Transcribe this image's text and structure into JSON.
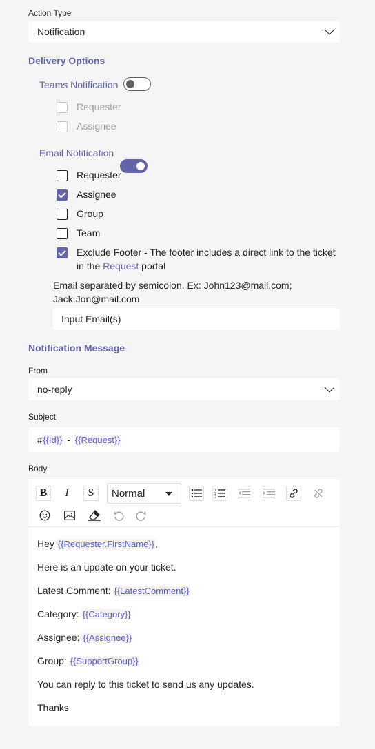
{
  "action_type": {
    "label": "Action Type",
    "value": "Notification"
  },
  "delivery": {
    "title": "Delivery Options",
    "teams": {
      "label": "Teams Notification",
      "enabled": false,
      "options": [
        {
          "label": "Requester",
          "checked": false,
          "disabled": true
        },
        {
          "label": "Assignee",
          "checked": false,
          "disabled": true
        }
      ]
    },
    "email": {
      "label": "Email Notification",
      "enabled": true,
      "options": [
        {
          "label": "Requester",
          "checked": false
        },
        {
          "label": "Assignee",
          "checked": true
        },
        {
          "label": "Group",
          "checked": false
        },
        {
          "label": "Team",
          "checked": false
        }
      ],
      "exclude_footer": {
        "checked": true,
        "line1": "Exclude Footer - The footer includes a direct link to the ticket",
        "line2_pre": "in the ",
        "line2_link": "Request",
        "line2_post": " portal"
      },
      "hint_line1": "Email separated by semicolon. Ex: John123@mail.com;",
      "hint_line2": "Jack.Jon@mail.com",
      "input_placeholder": "Input Email(s)"
    }
  },
  "message": {
    "title": "Notification Message",
    "from_label": "From",
    "from_value": "no-reply",
    "subject_label": "Subject",
    "subject": {
      "hash": "#",
      "id_token": "{{Id}}",
      "sep": "-",
      "request_token": "{{Request}}"
    },
    "body_label": "Body",
    "toolbar": {
      "bold": "B",
      "italic": "I",
      "strike": "S",
      "format_select": "Normal",
      "icons": [
        "bullet-list-icon",
        "numbered-list-icon",
        "outdent-icon",
        "indent-icon",
        "link-icon",
        "unlink-icon",
        "emoji-icon",
        "image-icon",
        "eraser-icon",
        "undo-icon",
        "redo-icon"
      ]
    },
    "body": {
      "greeting": "Hey",
      "greeting_token": "{{Requester.FirstName}}",
      "greeting_end": ",",
      "update_line": "Here is an update on your ticket.",
      "latest_comment_label": "Latest Comment:",
      "latest_comment_token": "{{LatestComment}}",
      "category_label": "Category:",
      "category_token": "{{Category}}",
      "assignee_label": "Assignee:",
      "assignee_token": "{{Assignee}}",
      "group_label": "Group:",
      "group_token": "{{SupportGroup}}",
      "reply_line": "You can reply to this ticket to send us any updates.",
      "signoff": "Thanks"
    }
  },
  "colors": {
    "accent": "#6264a7",
    "background": "#f5f5f5",
    "token": "#5b5fc7"
  }
}
